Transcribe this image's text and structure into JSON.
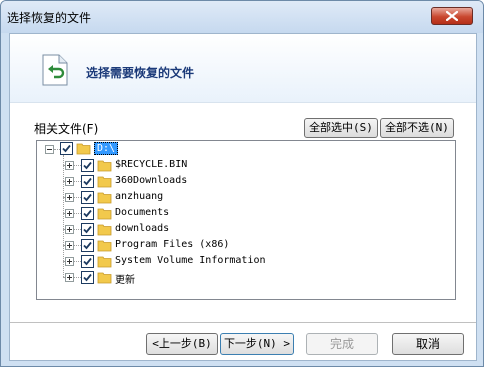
{
  "window": {
    "title": "选择恢复的文件",
    "close_icon": "close-x-icon"
  },
  "header": {
    "title": "选择需要恢复的文件",
    "icon": "restore-file-icon"
  },
  "files_label": "相关文件(F)",
  "buttons": {
    "select_all": "全部选中(S)",
    "deselect_all": "全部不选(N)",
    "back": "<上一步(B)",
    "next": "下一步(N) >",
    "finish": "完成",
    "cancel": "取消"
  },
  "tree": {
    "root": {
      "label": "D:\\",
      "checked": true,
      "expanded": true
    },
    "children": [
      {
        "label": "$RECYCLE.BIN",
        "checked": true
      },
      {
        "label": "360Downloads",
        "checked": true
      },
      {
        "label": "anzhuang",
        "checked": true
      },
      {
        "label": "Documents",
        "checked": true
      },
      {
        "label": "downloads",
        "checked": true
      },
      {
        "label": "Program Files (x86)",
        "checked": true
      },
      {
        "label": "System Volume Information",
        "checked": true
      },
      {
        "label": "更新",
        "checked": true
      }
    ]
  },
  "colors": {
    "accent": "#1b3a79",
    "folder": "#f2c94c",
    "check": "#1c3a60",
    "close": "#c9472f"
  }
}
